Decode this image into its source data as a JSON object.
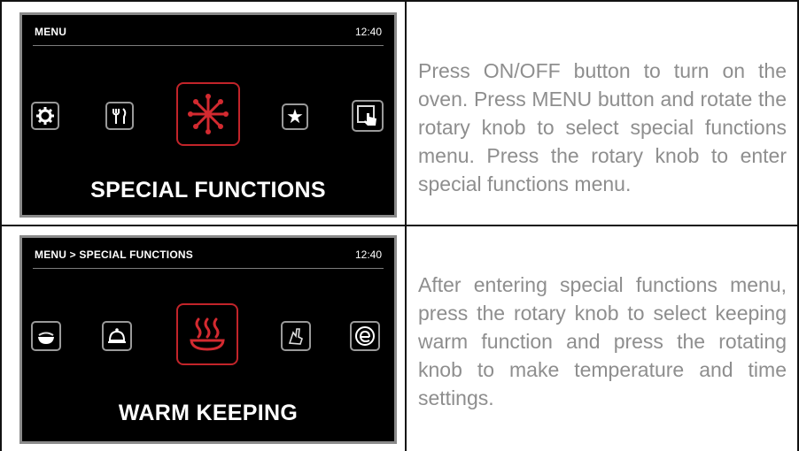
{
  "rows": [
    {
      "screen": {
        "title": "MENU",
        "time": "12:40",
        "caption": "SPECIAL FUNCTIONS",
        "icons": [
          "gear-icon",
          "fork-knife-icon",
          "defrost-snowflake-icon",
          "star-icon",
          "hand-touch-icon"
        ],
        "selected": "defrost-snowflake-icon"
      },
      "description": "Press ON/OFF button to turn on the oven. Press MENU button and rotate the rotary knob to select special functions menu. Press the rotary knob to enter special functions menu."
    },
    {
      "screen": {
        "title": "MENU > SPECIAL FUNCTIONS",
        "time": "12:40",
        "caption": "WARM KEEPING",
        "icons": [
          "bowl-icon",
          "dome-icon",
          "warm-keeping-icon",
          "hand-clean-icon",
          "eco-icon"
        ],
        "selected": "warm-keeping-icon"
      },
      "description": "After entering special functions menu, press the rotary knob to select keeping warm function and press the rotating knob to make temperature and time settings."
    }
  ],
  "colors": {
    "screen_bg": "#000000",
    "accent": "#c2242a",
    "text_gray": "#8e8e8e"
  }
}
